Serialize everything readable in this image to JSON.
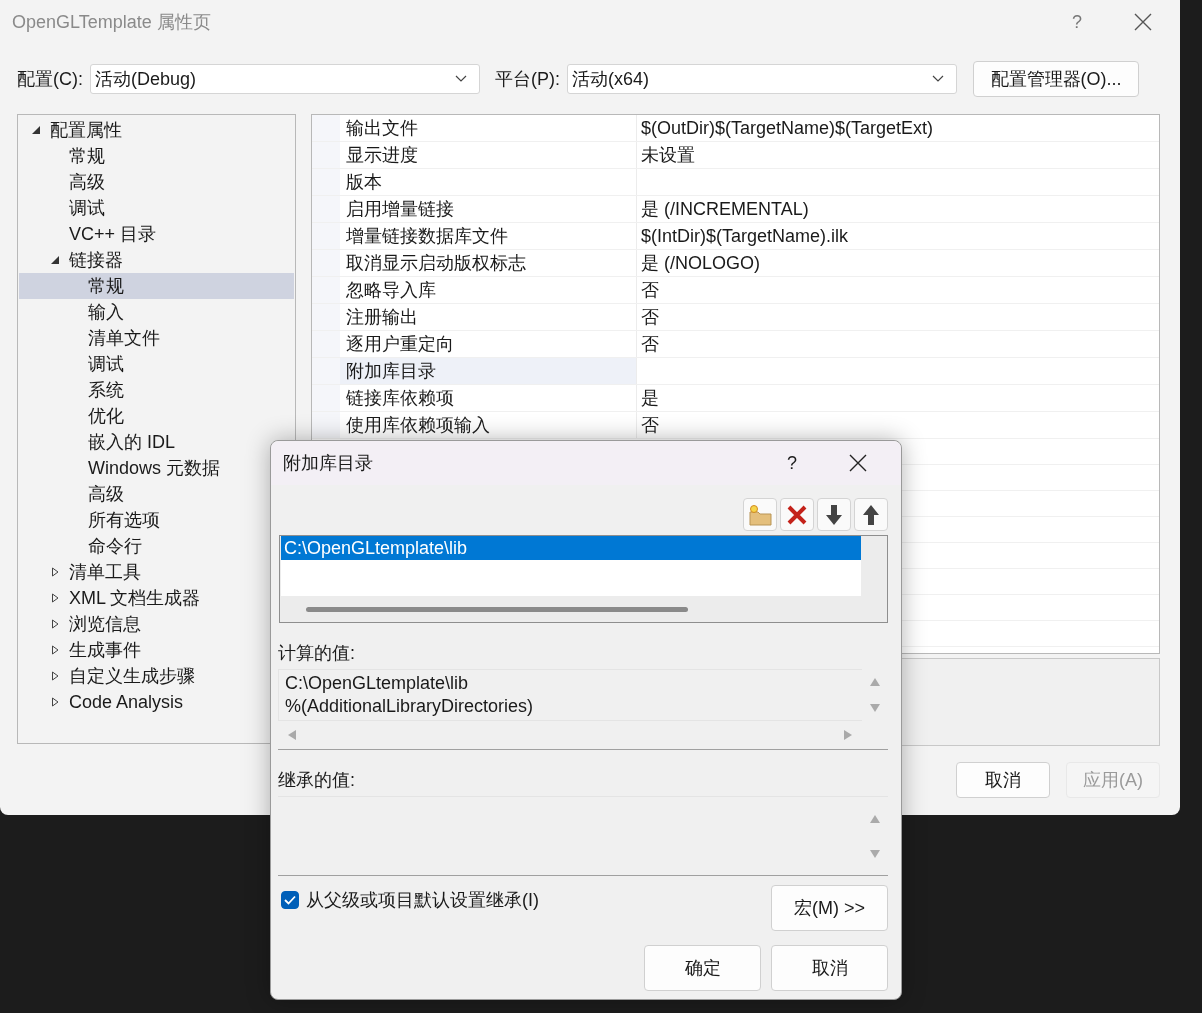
{
  "window": {
    "title": "OpenGLTemplate 属性页",
    "help": "?"
  },
  "config_bar": {
    "config_label": "配置(C):",
    "config_value": "活动(Debug)",
    "platform_label": "平台(P):",
    "platform_value": "活动(x64)",
    "manager_button": "配置管理器(O)..."
  },
  "tree": [
    {
      "label": "配置属性",
      "expanded": true,
      "selected": false,
      "children": [
        {
          "label": "常规",
          "selected": false
        },
        {
          "label": "高级",
          "selected": false
        },
        {
          "label": "调试",
          "selected": false
        },
        {
          "label": "VC++ 目录",
          "selected": false
        },
        {
          "label": "链接器",
          "expanded": true,
          "selected": false,
          "children": [
            {
              "label": "常规",
              "selected": true
            },
            {
              "label": "输入",
              "selected": false
            },
            {
              "label": "清单文件",
              "selected": false
            },
            {
              "label": "调试",
              "selected": false
            },
            {
              "label": "系统",
              "selected": false
            },
            {
              "label": "优化",
              "selected": false
            },
            {
              "label": "嵌入的 IDL",
              "selected": false
            },
            {
              "label": "Windows 元数据",
              "selected": false
            },
            {
              "label": "高级",
              "selected": false
            },
            {
              "label": "所有选项",
              "selected": false
            },
            {
              "label": "命令行",
              "selected": false
            }
          ]
        },
        {
          "label": "清单工具",
          "expanded": false,
          "selected": false
        },
        {
          "label": "XML 文档生成器",
          "expanded": false,
          "selected": false
        },
        {
          "label": "浏览信息",
          "expanded": false,
          "selected": false
        },
        {
          "label": "生成事件",
          "expanded": false,
          "selected": false
        },
        {
          "label": "自定义生成步骤",
          "expanded": false,
          "selected": false
        },
        {
          "label": "Code Analysis",
          "expanded": false,
          "selected": false
        }
      ]
    }
  ],
  "properties": [
    {
      "name": "输出文件",
      "value": "$(OutDir)$(TargetName)$(TargetExt)",
      "selected": false
    },
    {
      "name": "显示进度",
      "value": "未设置",
      "selected": false
    },
    {
      "name": "版本",
      "selected": false
    },
    {
      "name": "启用增量链接",
      "value": "是 (/INCREMENTAL)",
      "selected": false
    },
    {
      "name": "增量链接数据库文件",
      "value": "$(IntDir)$(TargetName).ilk",
      "selected": false
    },
    {
      "name": "取消显示启动版权标志",
      "value": "是 (/NOLOGO)",
      "selected": false
    },
    {
      "name": "忽略导入库",
      "value": "否",
      "selected": false
    },
    {
      "name": "注册输出",
      "value": "否",
      "selected": false
    },
    {
      "name": "逐用户重定向",
      "value": "否",
      "selected": false
    },
    {
      "name": "附加库目录",
      "selected": true
    },
    {
      "name": "链接库依赖项",
      "value": "是",
      "selected": false
    },
    {
      "name": "使用库依赖项输入",
      "value": "否",
      "selected": false
    }
  ],
  "buttons": [
    {
      "label": "取消",
      "disabled": false
    },
    {
      "label": "应用(A)",
      "disabled": true
    }
  ],
  "dialog": {
    "title": "附加库目录",
    "help": "?",
    "list": [
      {
        "text": "C:\\OpenGLtemplate\\lib",
        "selected": true
      }
    ],
    "computed_label": "计算的值:",
    "computed_lines": [
      "C:\\OpenGLtemplate\\lib",
      "%(AdditionalLibraryDirectories)"
    ],
    "inherited_label": "继承的值:",
    "inherit_checkbox": {
      "label": "从父级或项目默认设置继承(I)",
      "checked": true
    },
    "macro_button": "宏(M) >>",
    "buttons": [
      "确定",
      "取消"
    ]
  }
}
